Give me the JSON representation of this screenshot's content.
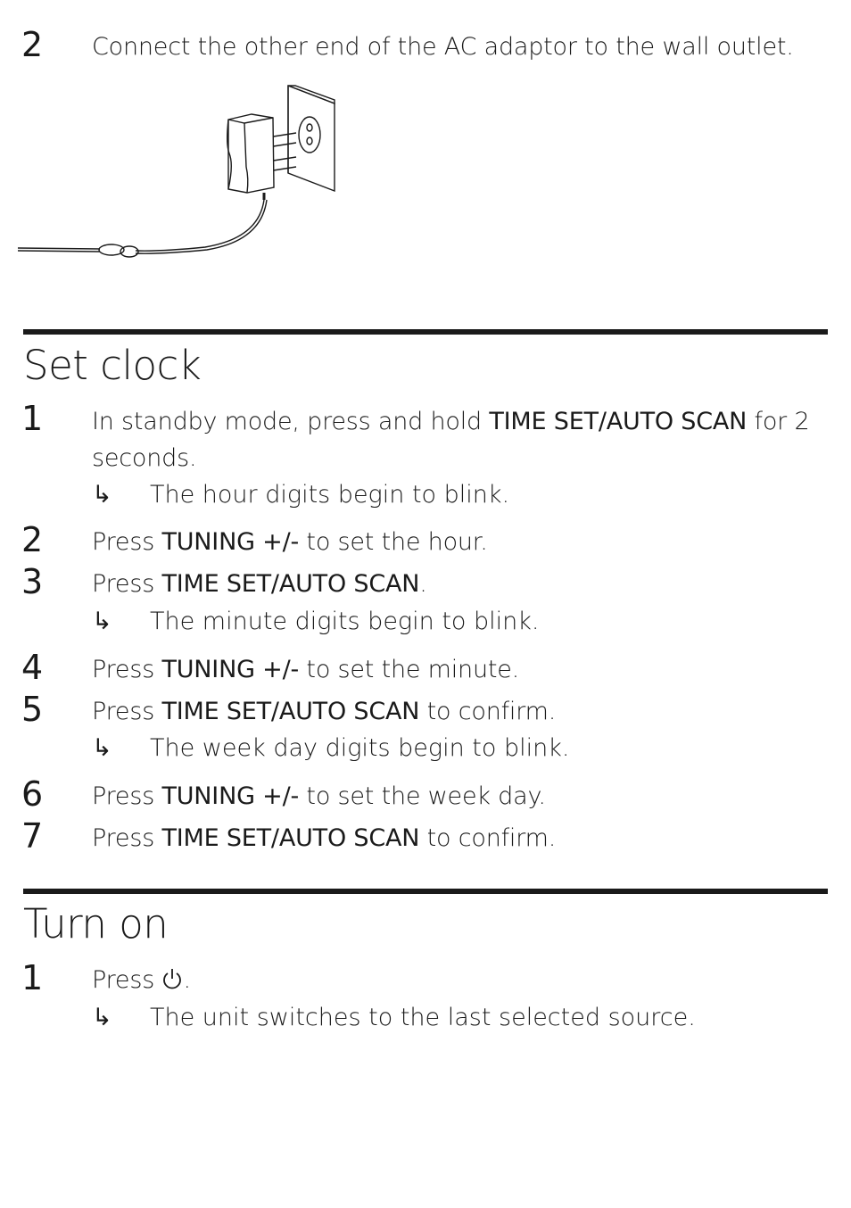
{
  "top_step": {
    "number": "2",
    "text": "Connect the other end of the AC adaptor to the wall outlet."
  },
  "illustration": {
    "icon": "ac-adaptor-wall-outlet-illustration"
  },
  "set_clock": {
    "heading": "Set clock",
    "steps": [
      {
        "number": "1",
        "pre": "In standby mode, press and hold ",
        "bold": "TIME SET/AUTO SCAN",
        "post": " for 2 seconds.",
        "result": "The hour digits begin to blink."
      },
      {
        "number": "2",
        "pre": "Press ",
        "bold": "TUNING +/-",
        "post": " to set the hour."
      },
      {
        "number": "3",
        "pre": "Press ",
        "bold": "TIME SET/AUTO SCAN",
        "post": ".",
        "result": "The minute digits begin to blink."
      },
      {
        "number": "4",
        "pre": "Press ",
        "bold": "TUNING +/-",
        "post": " to set the minute."
      },
      {
        "number": "5",
        "pre": "Press ",
        "bold": "TIME SET/AUTO SCAN",
        "post": " to confirm.",
        "result": "The week day digits begin to blink."
      },
      {
        "number": "6",
        "pre": "Press ",
        "bold": "TUNING +/-",
        "post": " to set the week day."
      },
      {
        "number": "7",
        "pre": "Press ",
        "bold": "TIME SET/AUTO SCAN",
        "post": " to confirm."
      }
    ]
  },
  "turn_on": {
    "heading": "Turn on",
    "steps": [
      {
        "number": "1",
        "pre": "Press ",
        "icon": "power-icon",
        "post": ".",
        "result": "The unit switches to the last selected source."
      }
    ]
  },
  "result_arrow": "↳"
}
